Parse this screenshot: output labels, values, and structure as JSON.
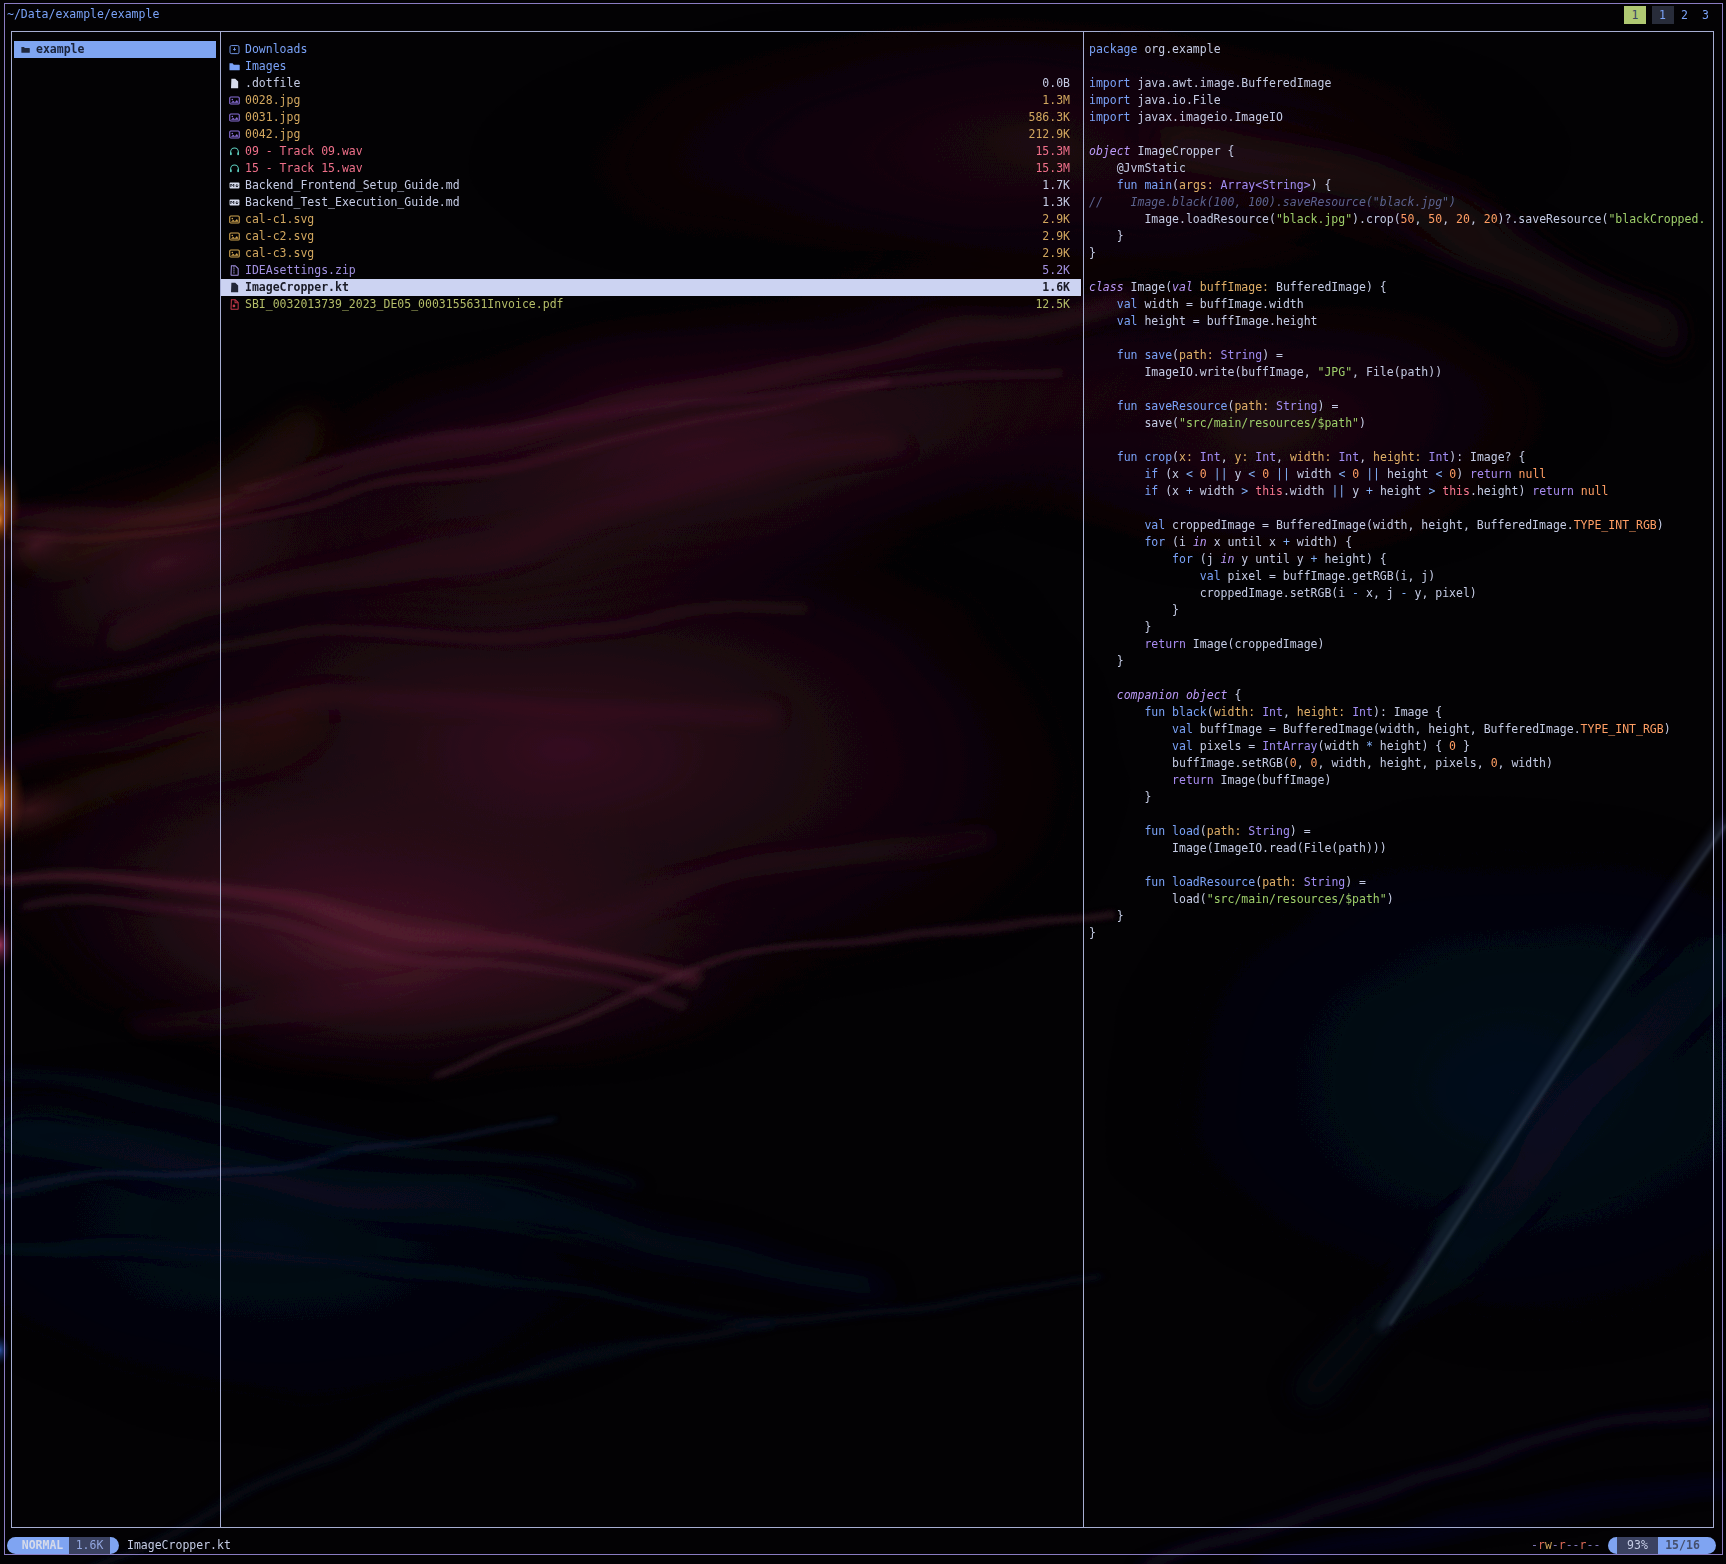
{
  "palette": {
    "fg": "#c4cbe4",
    "kw": "#7aa2f7",
    "kwi": "#bb9af7",
    "kwp": "#a88bf0",
    "fn": "#7aa2f7",
    "ty": "#a18df2",
    "pr": "#e0af68",
    "nm": "#ff9e64",
    "st": "#9ece6a",
    "cm": "#5b638f",
    "op": "#82b0f7",
    "th": "#f7768e",
    "blue": "#7aa2f7",
    "yellow": "#d2a75f",
    "violet": "#a291e0",
    "green": "#b4bd68",
    "red": "#f0708a",
    "teal": "#5fd0c0",
    "white": "#c4cbe4",
    "purpleIcon": "#8a6fd8",
    "goldIcon": "#cfa34f",
    "selBlueBg": "#7fa5f2",
    "selBlueFg": "#1a2238",
    "selLightBg": "#ccd3f2",
    "selLightFg": "#1a1b26",
    "statusDark": "#3b4261",
    "statusBlue": "#7fa4f2",
    "statusBlueFg": "#d5daea",
    "statusSizeFg": "#93a7e0",
    "posFg": "#45506e",
    "tabGreenBg": "#b0c973",
    "tabGreenFg": "#3d4663",
    "tabDarkBg": "#282c3a",
    "permDash": "#7e74b5",
    "permR": "#d96856",
    "permW": "#cfa45a"
  },
  "header": {
    "path": "~/Data/example/example",
    "tabs": [
      {
        "label": "1",
        "style": "green"
      },
      {
        "label": "1",
        "style": "dark"
      },
      {
        "label": "2",
        "style": "plain"
      },
      {
        "label": "3",
        "style": "plain"
      }
    ]
  },
  "parent_pane": {
    "items": [
      {
        "name": "example",
        "icon": "folder-icon",
        "selected": true
      }
    ]
  },
  "file_list": [
    {
      "name": "Downloads",
      "size": "",
      "color": "blue",
      "icon": "folder-download-icon"
    },
    {
      "name": "Images",
      "size": "",
      "color": "blue",
      "icon": "folder-icon"
    },
    {
      "name": ".dotfile",
      "size": "0.0B",
      "color": "white",
      "icon": "file-icon"
    },
    {
      "name": "0028.jpg",
      "size": "1.3M",
      "color": "yellow",
      "icon": "image-purple-icon"
    },
    {
      "name": "0031.jpg",
      "size": "586.3K",
      "color": "yellow",
      "icon": "image-purple-icon"
    },
    {
      "name": "0042.jpg",
      "size": "212.9K",
      "color": "yellow",
      "icon": "image-purple-icon"
    },
    {
      "name": "09 - Track 09.wav",
      "size": "15.3M",
      "color": "red",
      "icon": "headphones-icon"
    },
    {
      "name": "15 - Track 15.wav",
      "size": "15.3M",
      "color": "red",
      "icon": "headphones-icon"
    },
    {
      "name": "Backend_Frontend_Setup_Guide.md",
      "size": "1.7K",
      "color": "white",
      "icon": "markdown-icon"
    },
    {
      "name": "Backend_Test_Execution_Guide.md",
      "size": "1.3K",
      "color": "white",
      "icon": "markdown-icon"
    },
    {
      "name": "cal-c1.svg",
      "size": "2.9K",
      "color": "yellow",
      "icon": "image-gold-icon"
    },
    {
      "name": "cal-c2.svg",
      "size": "2.9K",
      "color": "yellow",
      "icon": "image-gold-icon"
    },
    {
      "name": "cal-c3.svg",
      "size": "2.9K",
      "color": "yellow",
      "icon": "image-gold-icon"
    },
    {
      "name": "IDEAsettings.zip",
      "size": "5.2K",
      "color": "violet",
      "icon": "zip-icon"
    },
    {
      "name": "ImageCropper.kt",
      "size": "1.6K",
      "color": "selected",
      "icon": "file-dark-icon",
      "selected": true
    },
    {
      "name": "SBI_0032013739_2023_DE05_0003155631Invoice.pdf",
      "size": "12.5K",
      "color": "green",
      "icon": "pdf-icon"
    }
  ],
  "code_lines": [
    [
      [
        "kw",
        "package"
      ],
      [
        "fg",
        " org.example"
      ]
    ],
    [],
    [
      [
        "kw",
        "import"
      ],
      [
        "fg",
        " java.awt.image.BufferedImage"
      ]
    ],
    [
      [
        "kw",
        "import"
      ],
      [
        "fg",
        " java.io.File"
      ]
    ],
    [
      [
        "kw",
        "import"
      ],
      [
        "fg",
        " javax.imageio.ImageIO"
      ]
    ],
    [],
    [
      [
        "kwi",
        "object"
      ],
      [
        "fg",
        " ImageCropper {"
      ]
    ],
    [
      [
        "fg",
        "    @JvmStatic"
      ]
    ],
    [
      [
        "fg",
        "    "
      ],
      [
        "kw",
        "fun"
      ],
      [
        "fn",
        " main"
      ],
      [
        "fg",
        "("
      ],
      [
        "pr",
        "args:"
      ],
      [
        "fg",
        " "
      ],
      [
        "ty",
        "Array<String>"
      ],
      [
        "fg",
        ") {"
      ]
    ],
    [
      [
        "cm",
        "//    Image.black(100, 100).saveResource(\"black.jpg\")"
      ]
    ],
    [
      [
        "fg",
        "        Image.loadResource("
      ],
      [
        "st",
        "\"black.jpg\""
      ],
      [
        "fg",
        ").crop("
      ],
      [
        "nm",
        "50"
      ],
      [
        "fg",
        ", "
      ],
      [
        "nm",
        "50"
      ],
      [
        "fg",
        ", "
      ],
      [
        "nm",
        "20"
      ],
      [
        "fg",
        ", "
      ],
      [
        "nm",
        "20"
      ],
      [
        "fg",
        ")?.saveResource("
      ],
      [
        "st",
        "\"blackCropped."
      ]
    ],
    [
      [
        "fg",
        "    }"
      ]
    ],
    [
      [
        "fg",
        "}"
      ]
    ],
    [],
    [
      [
        "kwi",
        "class"
      ],
      [
        "fg",
        " Image("
      ],
      [
        "kwi",
        "val"
      ],
      [
        "fg",
        " "
      ],
      [
        "pr",
        "buffImage:"
      ],
      [
        "fg",
        " BufferedImage) {"
      ]
    ],
    [
      [
        "fg",
        "    "
      ],
      [
        "kw",
        "val"
      ],
      [
        "fg",
        " width = buffImage.width"
      ]
    ],
    [
      [
        "fg",
        "    "
      ],
      [
        "kw",
        "val"
      ],
      [
        "fg",
        " height = buffImage.height"
      ]
    ],
    [],
    [
      [
        "fg",
        "    "
      ],
      [
        "kw",
        "fun"
      ],
      [
        "fn",
        " save"
      ],
      [
        "fg",
        "("
      ],
      [
        "pr",
        "path:"
      ],
      [
        "fg",
        " "
      ],
      [
        "ty",
        "String"
      ],
      [
        "fg",
        ") ="
      ]
    ],
    [
      [
        "fg",
        "        ImageIO.write(buffImage, "
      ],
      [
        "st",
        "\"JPG\""
      ],
      [
        "fg",
        ", File(path))"
      ]
    ],
    [],
    [
      [
        "fg",
        "    "
      ],
      [
        "kw",
        "fun"
      ],
      [
        "fn",
        " saveResource"
      ],
      [
        "fg",
        "("
      ],
      [
        "pr",
        "path:"
      ],
      [
        "fg",
        " "
      ],
      [
        "ty",
        "String"
      ],
      [
        "fg",
        ") ="
      ]
    ],
    [
      [
        "fg",
        "        save("
      ],
      [
        "st",
        "\"src/main/resources/$path\""
      ],
      [
        "fg",
        ")"
      ]
    ],
    [],
    [
      [
        "fg",
        "    "
      ],
      [
        "kw",
        "fun"
      ],
      [
        "fn",
        " crop"
      ],
      [
        "fg",
        "("
      ],
      [
        "pr",
        "x:"
      ],
      [
        "fg",
        " "
      ],
      [
        "ty",
        "Int"
      ],
      [
        "fg",
        ", "
      ],
      [
        "pr",
        "y:"
      ],
      [
        "fg",
        " "
      ],
      [
        "ty",
        "Int"
      ],
      [
        "fg",
        ", "
      ],
      [
        "pr",
        "width:"
      ],
      [
        "fg",
        " "
      ],
      [
        "ty",
        "Int"
      ],
      [
        "fg",
        ", "
      ],
      [
        "pr",
        "height:"
      ],
      [
        "fg",
        " "
      ],
      [
        "ty",
        "Int"
      ],
      [
        "fg",
        "): Image? {"
      ]
    ],
    [
      [
        "fg",
        "        "
      ],
      [
        "kw",
        "if"
      ],
      [
        "fg",
        " (x "
      ],
      [
        "op",
        "<"
      ],
      [
        "fg",
        " "
      ],
      [
        "nm",
        "0"
      ],
      [
        "fg",
        " "
      ],
      [
        "op",
        "||"
      ],
      [
        "fg",
        " y "
      ],
      [
        "op",
        "<"
      ],
      [
        "fg",
        " "
      ],
      [
        "nm",
        "0"
      ],
      [
        "fg",
        " "
      ],
      [
        "op",
        "||"
      ],
      [
        "fg",
        " width "
      ],
      [
        "op",
        "<"
      ],
      [
        "fg",
        " "
      ],
      [
        "nm",
        "0"
      ],
      [
        "fg",
        " "
      ],
      [
        "op",
        "||"
      ],
      [
        "fg",
        " height "
      ],
      [
        "op",
        "<"
      ],
      [
        "fg",
        " "
      ],
      [
        "nm",
        "0"
      ],
      [
        "fg",
        ") "
      ],
      [
        "kwp",
        "return"
      ],
      [
        "fg",
        " "
      ],
      [
        "nm",
        "null"
      ]
    ],
    [
      [
        "fg",
        "        "
      ],
      [
        "kw",
        "if"
      ],
      [
        "fg",
        " (x "
      ],
      [
        "op",
        "+"
      ],
      [
        "fg",
        " width "
      ],
      [
        "op",
        ">"
      ],
      [
        "fg",
        " "
      ],
      [
        "th",
        "this"
      ],
      [
        "fg",
        ".width "
      ],
      [
        "op",
        "||"
      ],
      [
        "fg",
        " y "
      ],
      [
        "op",
        "+"
      ],
      [
        "fg",
        " height "
      ],
      [
        "op",
        ">"
      ],
      [
        "fg",
        " "
      ],
      [
        "th",
        "this"
      ],
      [
        "fg",
        ".height) "
      ],
      [
        "kwp",
        "return"
      ],
      [
        "fg",
        " "
      ],
      [
        "nm",
        "null"
      ]
    ],
    [],
    [
      [
        "fg",
        "        "
      ],
      [
        "kw",
        "val"
      ],
      [
        "fg",
        " croppedImage = BufferedImage(width, height, BufferedImage."
      ],
      [
        "nm",
        "TYPE_INT_RGB"
      ],
      [
        "fg",
        ")"
      ]
    ],
    [
      [
        "fg",
        "        "
      ],
      [
        "kw",
        "for"
      ],
      [
        "fg",
        " (i "
      ],
      [
        "kwi",
        "in"
      ],
      [
        "fg",
        " x until x "
      ],
      [
        "op",
        "+"
      ],
      [
        "fg",
        " width) {"
      ]
    ],
    [
      [
        "fg",
        "            "
      ],
      [
        "kw",
        "for"
      ],
      [
        "fg",
        " (j "
      ],
      [
        "kwi",
        "in"
      ],
      [
        "fg",
        " y until y "
      ],
      [
        "op",
        "+"
      ],
      [
        "fg",
        " height) {"
      ]
    ],
    [
      [
        "fg",
        "                "
      ],
      [
        "kw",
        "val"
      ],
      [
        "fg",
        " pixel = buffImage.getRGB(i, j)"
      ]
    ],
    [
      [
        "fg",
        "                croppedImage.setRGB(i "
      ],
      [
        "op",
        "-"
      ],
      [
        "fg",
        " x, j "
      ],
      [
        "op",
        "-"
      ],
      [
        "fg",
        " y, pixel)"
      ]
    ],
    [
      [
        "fg",
        "            }"
      ]
    ],
    [
      [
        "fg",
        "        }"
      ]
    ],
    [
      [
        "fg",
        "        "
      ],
      [
        "kwp",
        "return"
      ],
      [
        "fg",
        " Image(croppedImage)"
      ]
    ],
    [
      [
        "fg",
        "    }"
      ]
    ],
    [],
    [
      [
        "fg",
        "    "
      ],
      [
        "kwi",
        "companion object"
      ],
      [
        "fg",
        " {"
      ]
    ],
    [
      [
        "fg",
        "        "
      ],
      [
        "kw",
        "fun"
      ],
      [
        "fn",
        " black"
      ],
      [
        "fg",
        "("
      ],
      [
        "pr",
        "width:"
      ],
      [
        "fg",
        " "
      ],
      [
        "ty",
        "Int"
      ],
      [
        "fg",
        ", "
      ],
      [
        "pr",
        "height:"
      ],
      [
        "fg",
        " "
      ],
      [
        "ty",
        "Int"
      ],
      [
        "fg",
        "): Image {"
      ]
    ],
    [
      [
        "fg",
        "            "
      ],
      [
        "kw",
        "val"
      ],
      [
        "fg",
        " buffImage = BufferedImage(width, height, BufferedImage."
      ],
      [
        "nm",
        "TYPE_INT_RGB"
      ],
      [
        "fg",
        ")"
      ]
    ],
    [
      [
        "fg",
        "            "
      ],
      [
        "kw",
        "val"
      ],
      [
        "fg",
        " pixels = "
      ],
      [
        "ty",
        "IntArray"
      ],
      [
        "fg",
        "(width "
      ],
      [
        "op",
        "*"
      ],
      [
        "fg",
        " height) { "
      ],
      [
        "nm",
        "0"
      ],
      [
        "fg",
        " }"
      ]
    ],
    [
      [
        "fg",
        "            buffImage.setRGB("
      ],
      [
        "nm",
        "0"
      ],
      [
        "fg",
        ", "
      ],
      [
        "nm",
        "0"
      ],
      [
        "fg",
        ", width, height, pixels, "
      ],
      [
        "nm",
        "0"
      ],
      [
        "fg",
        ", width)"
      ]
    ],
    [
      [
        "fg",
        "            "
      ],
      [
        "kwp",
        "return"
      ],
      [
        "fg",
        " Image(buffImage)"
      ]
    ],
    [
      [
        "fg",
        "        }"
      ]
    ],
    [],
    [
      [
        "fg",
        "        "
      ],
      [
        "kw",
        "fun"
      ],
      [
        "fn",
        " load"
      ],
      [
        "fg",
        "("
      ],
      [
        "pr",
        "path:"
      ],
      [
        "fg",
        " "
      ],
      [
        "ty",
        "String"
      ],
      [
        "fg",
        ") ="
      ]
    ],
    [
      [
        "fg",
        "            Image(ImageIO.read(File(path)))"
      ]
    ],
    [],
    [
      [
        "fg",
        "        "
      ],
      [
        "kw",
        "fun"
      ],
      [
        "fn",
        " loadResource"
      ],
      [
        "fg",
        "("
      ],
      [
        "pr",
        "path:"
      ],
      [
        "fg",
        " "
      ],
      [
        "ty",
        "String"
      ],
      [
        "fg",
        ") ="
      ]
    ],
    [
      [
        "fg",
        "            load("
      ],
      [
        "st",
        "\"src/main/resources/$path\""
      ],
      [
        "fg",
        ")"
      ]
    ],
    [
      [
        "fg",
        "    }"
      ]
    ],
    [
      [
        "fg",
        "}"
      ]
    ]
  ],
  "status": {
    "mode": "NORMAL",
    "size": "1.6K",
    "filename": "ImageCropper.kt",
    "permissions": [
      [
        "permDash",
        "-"
      ],
      [
        "permR",
        "r"
      ],
      [
        "permW",
        "w"
      ],
      [
        "permDash",
        "-"
      ],
      [
        "permR",
        "r"
      ],
      [
        "permDash",
        "--"
      ],
      [
        "permR",
        "r"
      ],
      [
        "permDash",
        "--"
      ]
    ],
    "percent": "93%",
    "position": "15/16"
  }
}
